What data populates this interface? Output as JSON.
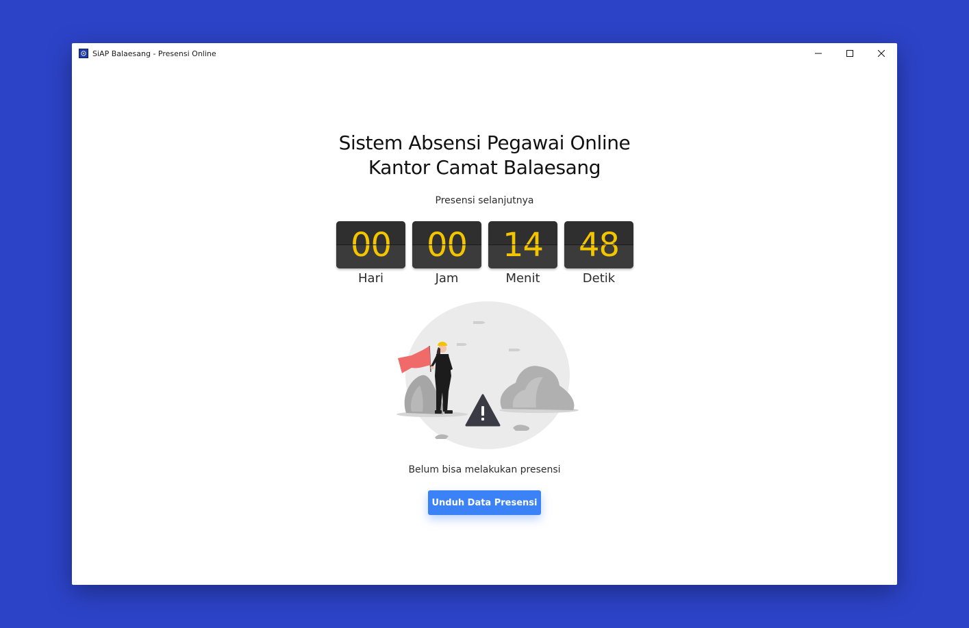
{
  "window": {
    "title": "SiAP Balaesang - Presensi Online",
    "controls": [
      "minimize",
      "maximize",
      "close"
    ]
  },
  "header": {
    "title_line1": "Sistem Absensi Pegawai Online",
    "title_line2": "Kantor Camat Balaesang",
    "subtitle": "Presensi selanjutnya"
  },
  "countdown": {
    "days": {
      "value": "00",
      "label": "Hari"
    },
    "hours": {
      "value": "00",
      "label": "Jam"
    },
    "minutes": {
      "value": "14",
      "label": "Menit"
    },
    "seconds": {
      "value": "48",
      "label": "Detik"
    }
  },
  "illustration": {
    "icon": "warning-worker-illustration"
  },
  "status": {
    "message": "Belum bisa melakukan presensi"
  },
  "actions": {
    "download_label": "Unduh Data Presensi"
  },
  "colors": {
    "desktop_background": "#2c43c8",
    "digit_color": "#f2c500",
    "button_color": "#3b82f6",
    "flag_color": "#f06a6a"
  }
}
